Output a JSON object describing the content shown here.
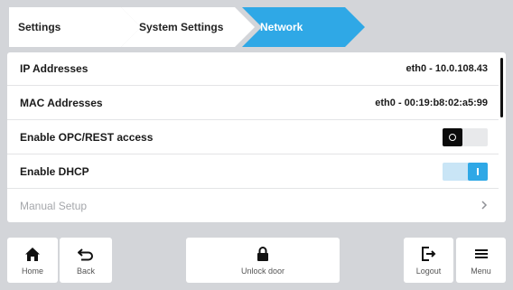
{
  "breadcrumb": {
    "items": [
      "Settings",
      "System Settings",
      "Network"
    ],
    "active_color": "#2fa8e6"
  },
  "settings": {
    "rows": [
      {
        "label": "IP Addresses",
        "value": "eth0 - 10.0.108.43"
      },
      {
        "label": "MAC Addresses",
        "value": "eth0 - 00:19:b8:02:a5:99"
      },
      {
        "label": "Enable OPC/REST access",
        "toggle": "off"
      },
      {
        "label": "Enable DHCP",
        "toggle": "on"
      },
      {
        "label": "Manual Setup",
        "disabled": true,
        "icon": "chevron-right-icon"
      }
    ]
  },
  "bottom_bar": {
    "home": {
      "label": "Home",
      "icon": "home-icon"
    },
    "back": {
      "label": "Back",
      "icon": "back-arrow-icon"
    },
    "unlock": {
      "label": "Unlock door",
      "icon": "lock-icon"
    },
    "logout": {
      "label": "Logout",
      "icon": "logout-icon"
    },
    "menu": {
      "label": "Menu",
      "icon": "menu-icon"
    }
  }
}
